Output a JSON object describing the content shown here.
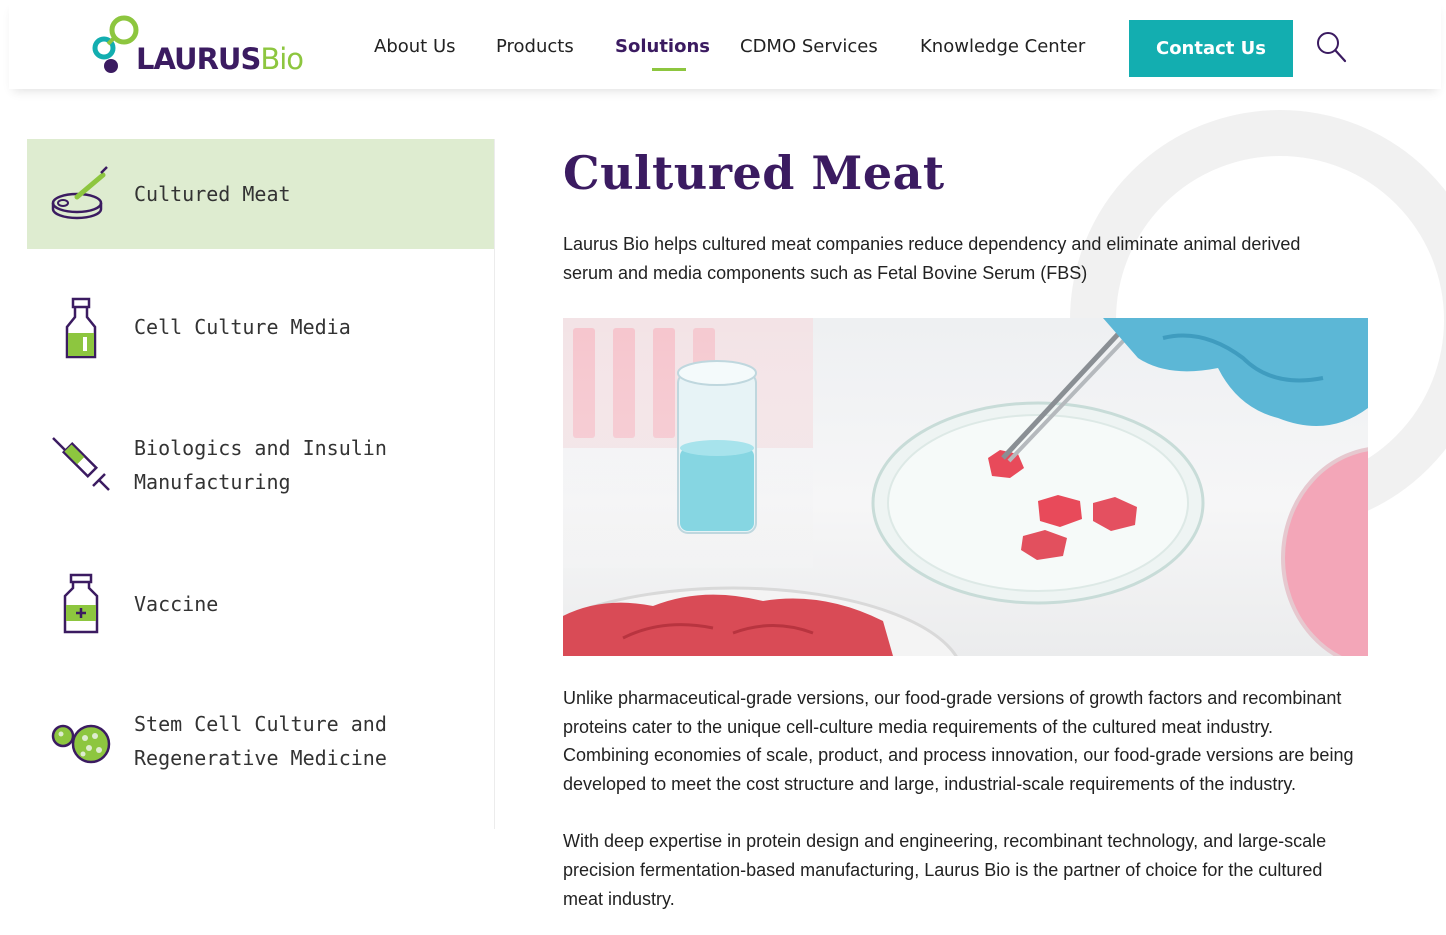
{
  "header": {
    "logo": {
      "word1": "LAURUS",
      "word2": "Bio"
    },
    "nav": [
      {
        "label": "About Us"
      },
      {
        "label": "Products"
      },
      {
        "label": "Solutions",
        "active": true
      },
      {
        "label": "CDMO Services"
      },
      {
        "label": "Knowledge Center"
      }
    ],
    "contact_label": "Contact Us",
    "search_icon": "search-icon"
  },
  "sidebar": {
    "items": [
      {
        "label": "Cultured Meat",
        "icon": "petri-dish-dropper-icon",
        "active": true
      },
      {
        "label": "Cell Culture Media",
        "icon": "flask-bottle-icon"
      },
      {
        "label": "Biologics and Insulin\nManufacturing",
        "icon": "syringe-icon"
      },
      {
        "label": "Vaccine",
        "icon": "vaccine-vial-icon"
      },
      {
        "label": "Stem Cell Culture and\nRegenerative Medicine",
        "icon": "cells-icon"
      }
    ]
  },
  "main": {
    "title": "Cultured Meat",
    "intro": "Laurus Bio helps cultured meat companies reduce dependency and eliminate animal derived serum and media components such as Fetal Bovine Serum (FBS)",
    "image_alt": "cultured-meat-petri-dish-photo",
    "paragraphs": [
      "Unlike pharmaceutical-grade versions, our food-grade versions of growth factors and recombinant proteins cater to the unique cell-culture media requirements of the cultured meat industry. Combining economies of scale, product, and process innovation, our food-grade versions are being developed to meet the cost structure and large, industrial-scale requirements of the industry.",
      "With deep expertise in protein design and engineering, recombinant technology, and large-scale precision fermentation-based manufacturing, Laurus Bio is the partner of choice for the cultured meat industry."
    ]
  },
  "colors": {
    "brand_purple": "#3b1b61",
    "brand_green": "#8dc63f",
    "button_teal": "#13aeb0",
    "active_bg": "#deecd0"
  }
}
